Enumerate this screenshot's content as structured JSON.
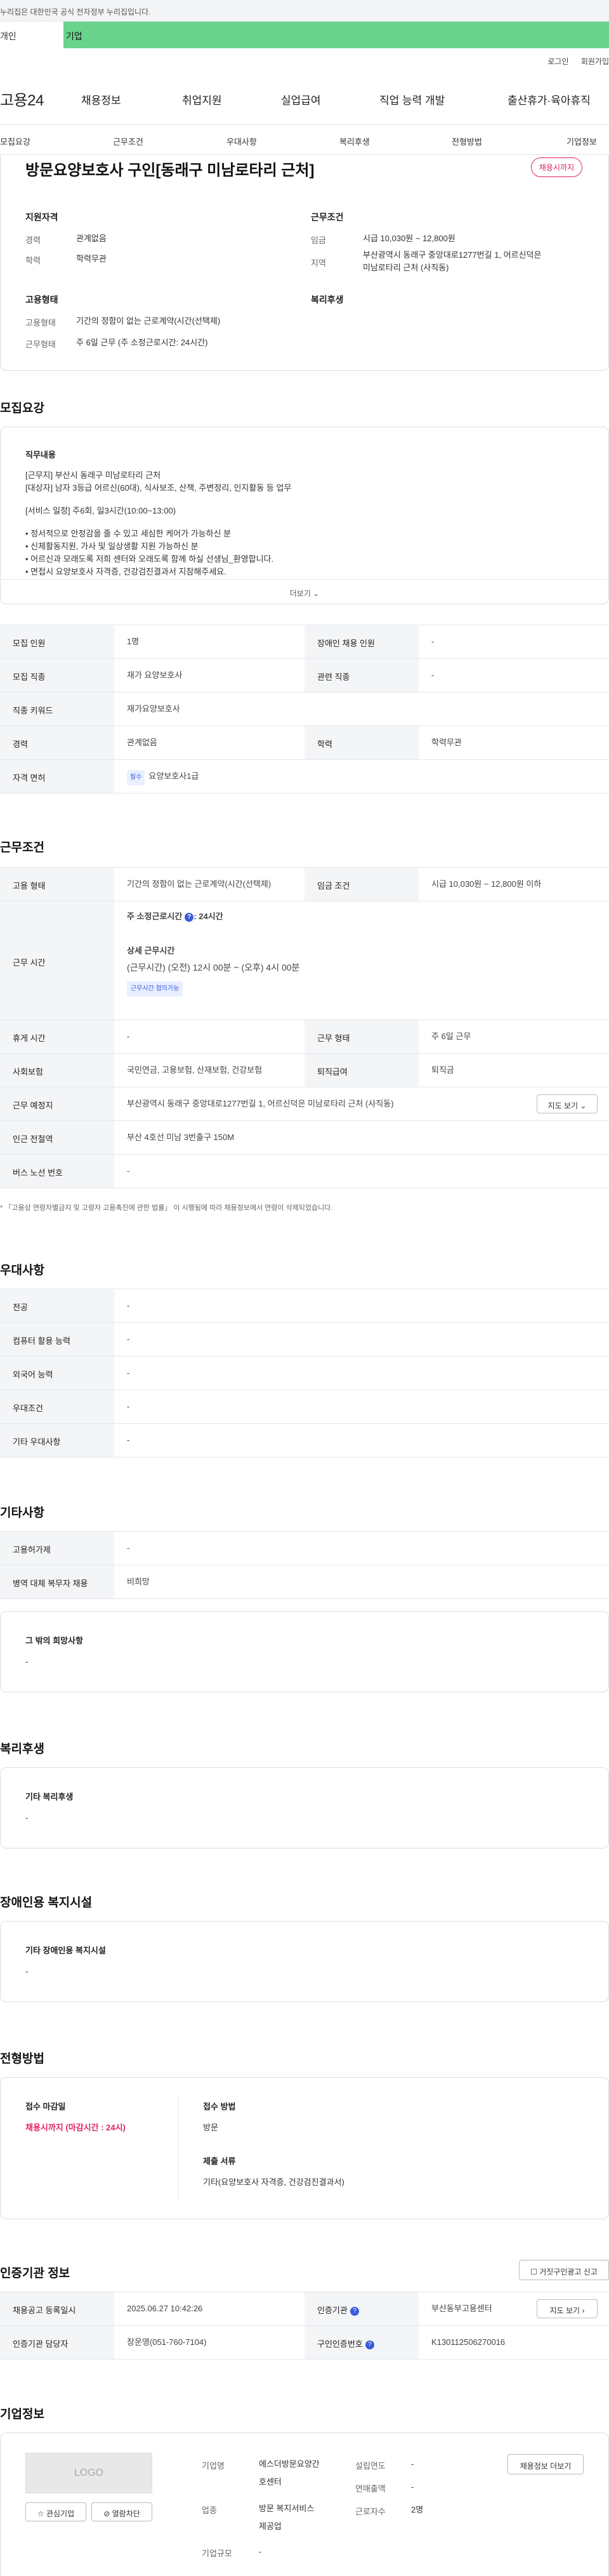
{
  "banner": {
    "text": "누리집은 대한민국 공식 전자정부 누리집입니다."
  },
  "user_tabs": {
    "individual": "개인",
    "business": "기업"
  },
  "top_links": {
    "login": "로그인",
    "signup": "회원가입"
  },
  "logo": {
    "text": "고용24"
  },
  "gnb": [
    "채용정보",
    "취업지원",
    "실업급여",
    "직업 능력 개발",
    "출산휴가·육아휴직"
  ],
  "subnav": [
    "모집요강",
    "근무조건",
    "우대사항",
    "복리후생",
    "전형방법",
    "기업정보"
  ],
  "job": {
    "title": "방문요양보호사 구인[동래구 미남로타리 근처]",
    "status_badge": "채용시까지",
    "qualification_heading": "지원자격",
    "career_label": "경력",
    "career_value": "관계없음",
    "education_label": "학력",
    "education_value": "학력무관",
    "condition_heading": "근무조건",
    "wage_label": "임금",
    "wage_value": "시급 10,030원 ~ 12,800원",
    "region_label": "지역",
    "region_value_1": "부산광역시 동래구 중앙대로1277번길 1, 어르신덕은",
    "region_value_2": "미남로타리 근처 (사직동)",
    "employment_heading": "고용형태",
    "emp_type_label": "고용형태",
    "emp_type_value": "기간의 정함이 없는 근로계약(시간(선택제)",
    "work_form_label": "근무형태",
    "work_form_value": "주 6일 근무 (주 소정근로시간: 24시간)",
    "welfare_heading": "복리후생"
  },
  "recruit": {
    "heading": "모집요강",
    "duty_heading": "직무내용",
    "duty_lines": [
      "[근무지] 부산시 동래구 미남로타리 근처",
      "[대상자] 남자 3등급 어르신(60대), 식사보조, 산책, 주변정리, 인지활동 등 업무",
      "",
      "[서비스 일정] 주6회, 일3시간(10:00~13:00)",
      "",
      "• 정서적으로 안정감을 줄 수 있고 세심한 케어가 가능하신 분",
      "• 신체활동지원, 가사 및 일상생활 지원 가능하신 분",
      "• 어르신과 모래도록 저희 센터와 오래도록 함께 하실 선생님_환영합니다.",
      "• 면접시 요양보호사 자격증, 건강검진결과서 지참해주세요."
    ],
    "more_label": "더보기",
    "rows": [
      {
        "k1": "모집 인원",
        "v1": "1명",
        "k2": "장애인 채용 인원",
        "v2": "-"
      },
      {
        "k1": "모집 직종",
        "v1": "재가 요양보호사",
        "k2": "관련 직종",
        "v2": "-"
      },
      {
        "k1": "직종 키워드",
        "v1": "재가요양보호사",
        "k2": "",
        "v2": ""
      },
      {
        "k1": "경력",
        "v1": "관계없음",
        "k2": "학력",
        "v2": "학력무관"
      }
    ],
    "license_label": "자격 면허",
    "license_tag": "필수",
    "license_value": "요양보호사1급"
  },
  "work": {
    "heading": "근무조건",
    "emp_label": "고용 형태",
    "emp_value": "기간의 정함이 없는 근로계약(시간(선택제)",
    "wage_label": "임금 조건",
    "wage_value": "시급 10,030원 ~ 12,800원 이하",
    "hours_label": "근무 시간",
    "hours_weekly": "주 소정근로시간",
    "hours_weekly_value": ": 24시간",
    "hours_detail_heading": "상세 근무시간",
    "hours_detail": "(근무시간) (오전) 12시 00분 ~ (오후) 4시 00분",
    "hours_tag": "근무시간 협의가능",
    "rest_label": "휴게 시간",
    "rest_value": "-",
    "form_label": "근무 형태",
    "form_value": "주 6일 근무",
    "insurance_label": "사회보험",
    "insurance_value": "국민연금, 고용보험, 산재보험, 건강보험",
    "retire_label": "퇴직급여",
    "retire_value": "퇴직금",
    "place_label": "근무 예정지",
    "place_value": "부산광역시 동래구 중앙대로1277번길 1, 어르신덕은 미남로타리 근처 (사직동)",
    "map_button": "지도 보기",
    "station_label": "인근 전철역",
    "station_value": "부산 4호선 미남 3번출구 150M",
    "bus_label": "버스 노선 번호",
    "bus_value": "-",
    "note": "* 「고용상 연령차별금지 및 고령자 고용촉진에 관한 법률」 이 시행됨에 따라 채용정보에서 연령이 삭제되었습니다."
  },
  "preference": {
    "heading": "우대사항",
    "rows": [
      {
        "k": "전공",
        "v": "-"
      },
      {
        "k": "컴퓨터 활용 능력",
        "v": "-"
      },
      {
        "k": "외국어 능력",
        "v": "-"
      },
      {
        "k": "우대조건",
        "v": "-"
      },
      {
        "k": "기타 우대사항",
        "v": "-"
      }
    ]
  },
  "etc": {
    "heading": "기타사항",
    "rows": [
      {
        "k": "고용허가제",
        "v": "-"
      },
      {
        "k": "병역 대체 복무자 채용",
        "v": "비희망"
      }
    ],
    "other_heading": "그 밖의 희망사항",
    "other_value": "-"
  },
  "welfare": {
    "heading": "복리후생",
    "sub": "기타 복리후생",
    "value": "-"
  },
  "disabled": {
    "heading": "장애인용 복지시설",
    "sub": "기타 장애인용 복지시설",
    "value": "-"
  },
  "selection": {
    "heading": "전형방법",
    "deadline_label": "접수 마감일",
    "deadline_value": "채용시까지 (마감시간 : 24시)",
    "method_label": "접수 방법",
    "method_value": "방문",
    "docs_label": "제출 서류",
    "docs_value": "기타(요양보호사 자격증, 건강검진결과서)"
  },
  "agency": {
    "heading": "인증기관 정보",
    "report_button": "거짓구인광고 신고",
    "reg_date_label": "채용공고 등록일시",
    "reg_date_value": "2025.06.27 10:42:26",
    "agency_label": "인증기관",
    "agency_value": "부산동부고용센터",
    "map_button": "지도 보기",
    "manager_label": "인증기관 담당자",
    "manager_value": "장운영(051-760-7104)",
    "job_no_label": "구인인증번호",
    "job_no_value": "K130112506270016"
  },
  "company": {
    "heading": "기업정보",
    "logo_text": "LOGO",
    "fav_button": "관심기업",
    "block_button": "열람차단",
    "name_label": "기업명",
    "name_value_1": "에스더방문요양간",
    "name_value_2": "호센터",
    "industry_label": "업종",
    "industry_value_1": "방문 복지서비스",
    "industry_value_2": "제공업",
    "size_label": "기업규모",
    "size_value": "-",
    "founded_label": "설립연도",
    "founded_value": "-",
    "revenue_label": "연매출액",
    "revenue_value": "-",
    "employees_label": "근로자수",
    "employees_value": "2명",
    "more_button": "채용정보 더보기"
  }
}
